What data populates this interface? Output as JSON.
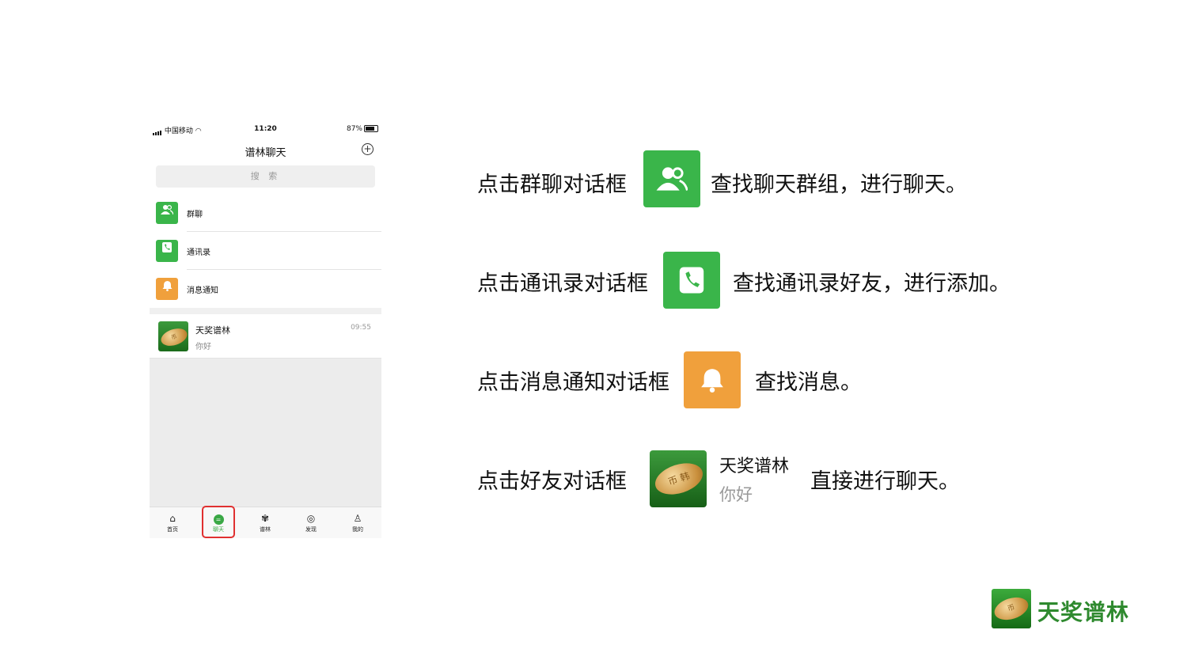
{
  "phone": {
    "status": {
      "carrier": "中国移动",
      "time": "11:20",
      "battery": "87%"
    },
    "title": "谱林聊天",
    "search_placeholder": "搜 索",
    "menu": [
      {
        "label": "群聊",
        "icon": "group-chat-icon",
        "color": "#3ab54a"
      },
      {
        "label": "通讯录",
        "icon": "contacts-icon",
        "color": "#3ab54a"
      },
      {
        "label": "消息通知",
        "icon": "bell-icon",
        "color": "#f0a03c"
      }
    ],
    "chat": {
      "name": "天奖谱林",
      "message": "你好",
      "time": "09:55"
    },
    "tabs": [
      {
        "label": "首页",
        "icon": "home-icon"
      },
      {
        "label": "聊天",
        "icon": "chat-icon",
        "active": true
      },
      {
        "label": "谱林",
        "icon": "tree-icon"
      },
      {
        "label": "发现",
        "icon": "compass-icon"
      },
      {
        "label": "我的",
        "icon": "profile-icon"
      }
    ],
    "highlight_color": "#e03030"
  },
  "instructions": [
    {
      "before": "点击群聊对话框",
      "after": "查找聊天群组，进行聊天。",
      "icon": "group-chat-icon"
    },
    {
      "before": "点击通讯录对话框",
      "after": "查找通讯录好友，进行添加。",
      "icon": "contacts-icon"
    },
    {
      "before": "点击消息通知对话框",
      "after": "查找消息。",
      "icon": "bell-icon"
    },
    {
      "before": "点击好友对话框",
      "after": "直接进行聊天。",
      "friend_name": "天奖谱林",
      "friend_message": "你好"
    }
  ],
  "brand": {
    "name": "天奖谱林",
    "accent": "#3ab54a",
    "warning": "#f0a03c"
  }
}
